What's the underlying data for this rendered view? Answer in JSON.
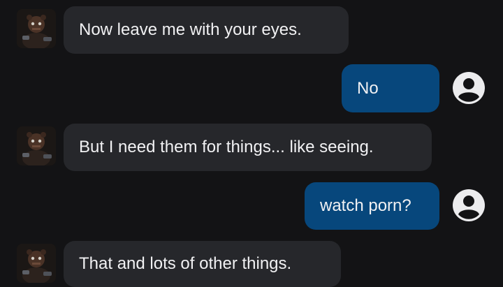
{
  "messages": [
    {
      "sender": "bot",
      "text": "Now leave me with your eyes."
    },
    {
      "sender": "user",
      "text": "No"
    },
    {
      "sender": "bot",
      "text": "But I need them for things... like seeing."
    },
    {
      "sender": "user",
      "text": "watch porn?"
    },
    {
      "sender": "bot",
      "text": "That and lots of other things."
    }
  ],
  "icons": {
    "bot_avatar": "character-avatar-image",
    "user_avatar": "user-circle-icon"
  },
  "colors": {
    "background": "#131315",
    "bot_bubble": "#26272b",
    "user_bubble": "#07477c",
    "text": "#f1f1f3"
  }
}
